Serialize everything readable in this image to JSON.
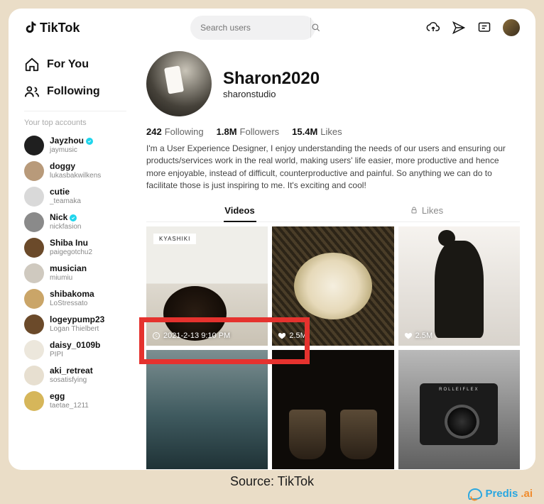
{
  "brand": "TikTok",
  "search": {
    "placeholder": "Search users"
  },
  "nav": {
    "forYou": "For You",
    "following": "Following",
    "topAccountsLabel": "Your top accounts"
  },
  "accounts": [
    {
      "name": "Jayzhou",
      "handle": "jaymusic",
      "verified": true,
      "avatarColor": "#1f1f1f"
    },
    {
      "name": "doggy",
      "handle": "lukasbakwilkens",
      "verified": false,
      "avatarColor": "#b89a7a"
    },
    {
      "name": "cutie",
      "handle": "_teamaka",
      "verified": false,
      "avatarColor": "#d9d9d9"
    },
    {
      "name": "Nick",
      "handle": "nickfasion",
      "verified": true,
      "avatarColor": "#8a8a8a"
    },
    {
      "name": "Shiba Inu",
      "handle": "paigegotchu2",
      "verified": false,
      "avatarColor": "#6b4a2a"
    },
    {
      "name": "musician",
      "handle": "miumiu",
      "verified": false,
      "avatarColor": "#cfc9bf"
    },
    {
      "name": "shibakoma",
      "handle": "LoStressato",
      "verified": false,
      "avatarColor": "#caa568"
    },
    {
      "name": "logeypump23",
      "handle": "Logan Thielbert",
      "verified": false,
      "avatarColor": "#6b4a2a"
    },
    {
      "name": "daisy_0109b",
      "handle": "PIPI",
      "verified": false,
      "avatarColor": "#ece7dc"
    },
    {
      "name": "aki_retreat",
      "handle": "sosatisfying",
      "verified": false,
      "avatarColor": "#e7dfd0"
    },
    {
      "name": "egg",
      "handle": "taetae_1211",
      "verified": false,
      "avatarColor": "#d6b65a"
    }
  ],
  "profile": {
    "displayName": "Sharon2020",
    "username": "sharonstudio",
    "followingCount": "242",
    "followingLabel": "Following",
    "followersCount": "1.8M",
    "followersLabel": "Followers",
    "likesCount": "15.4M",
    "likesLabel": "Likes",
    "bio": "I'm a User Experience Designer, I enjoy understanding the needs of our users and ensuring our products/services work in the real world, making users' life easier, more productive and hence more enjoyable, instead of difficult, counterproductive and painful. So anything we can do to facilitate those is just inspiring to me. It's exciting and cool!"
  },
  "tabs": {
    "videos": "Videos",
    "likes": "Likes"
  },
  "grid": [
    {
      "overlay": "2021-2-13 9:10 PM",
      "overlayType": "time"
    },
    {
      "overlay": "2.5M",
      "overlayType": "heart"
    },
    {
      "overlay": "2.5M",
      "overlayType": "heart"
    },
    {
      "overlay": "",
      "overlayType": ""
    },
    {
      "overlay": "",
      "overlayType": ""
    },
    {
      "overlay": "",
      "overlayType": ""
    }
  ],
  "rolleiflexText": "ROLLEIFLEX",
  "caption": "Source: TikTok",
  "predis": {
    "t1": "Predis",
    "t2": ".ai"
  }
}
